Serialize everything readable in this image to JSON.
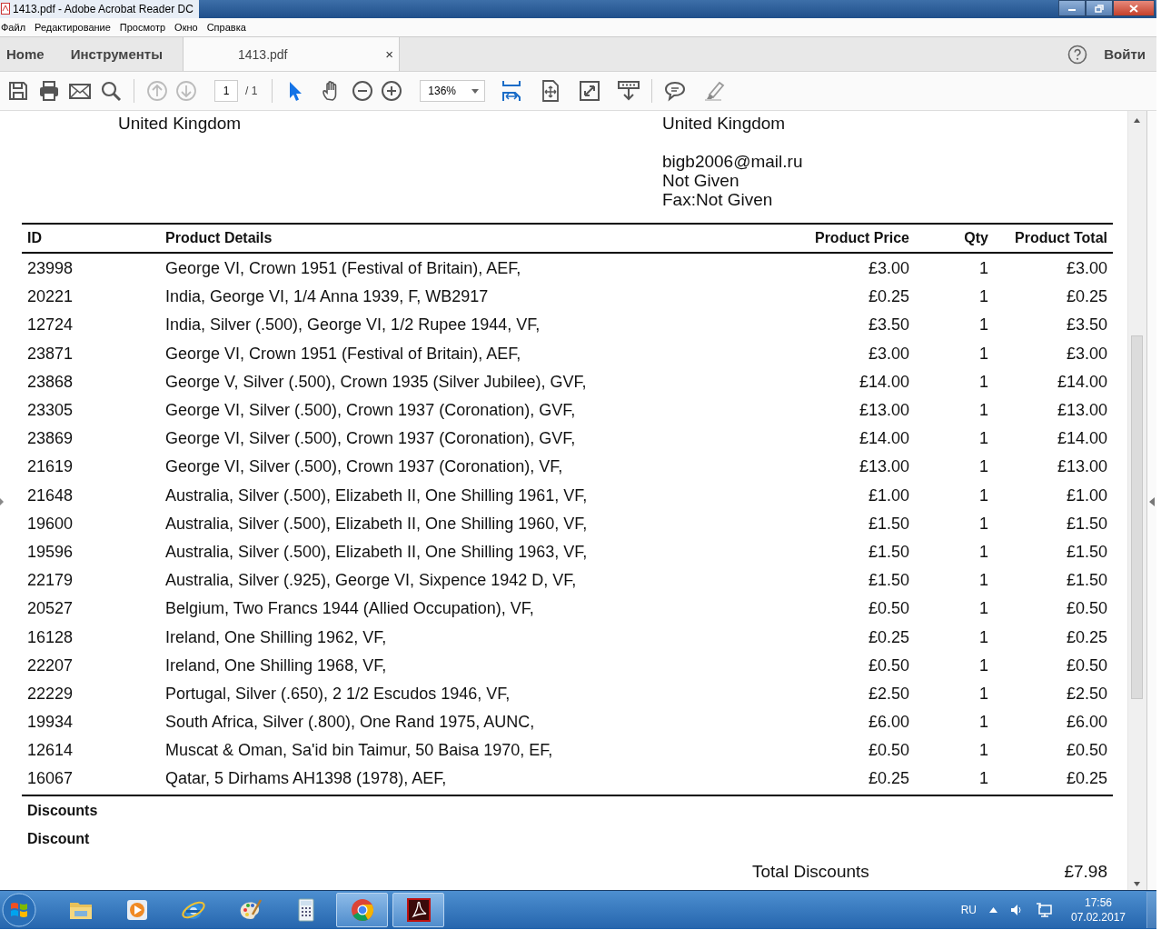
{
  "window": {
    "title": "1413.pdf - Adobe Acrobat Reader DC"
  },
  "menu": [
    "Файл",
    "Редактирование",
    "Просмотр",
    "Окно",
    "Справка"
  ],
  "tabs": [
    {
      "label": "Home",
      "kind": "nav",
      "selected": false
    },
    {
      "label": "Инструменты",
      "kind": "nav",
      "selected": false
    },
    {
      "label": "1413.pdf",
      "kind": "document",
      "close": "×",
      "selected": true
    }
  ],
  "sign_in": "Войти",
  "toolbar": {
    "prev_page_disabled": true,
    "next_page_disabled": true,
    "page": "1",
    "page_count": "/ 1",
    "zoom": "136%",
    "tools": [
      {
        "kind": "select",
        "selected": true
      },
      {
        "kind": "hand",
        "selected": false
      }
    ]
  },
  "document": {
    "sender_lines": [
      "United Kingdom"
    ],
    "recipient_lines": [
      "United Kingdom"
    ],
    "recipient_contact_lines": [
      "bigb2006@mail.ru",
      "Not Given",
      "Fax:Not Given"
    ],
    "table": {
      "columns": [
        "ID",
        "Product Details",
        "Product Price",
        "Qty",
        "Product Total"
      ],
      "rows": [
        [
          "23998",
          "George VI, Crown 1951 (Festival of Britain), AEF,",
          "£3.00",
          "1",
          "£3.00"
        ],
        [
          "20221",
          "India, George VI, 1/4 Anna 1939, F, WB2917",
          "£0.25",
          "1",
          "£0.25"
        ],
        [
          "12724",
          "India, Silver (.500), George VI, 1/2 Rupee 1944, VF,",
          "£3.50",
          "1",
          "£3.50"
        ],
        [
          "23871",
          "George VI, Crown 1951 (Festival of Britain), AEF,",
          "£3.00",
          "1",
          "£3.00"
        ],
        [
          "23868",
          "George V, Silver (.500), Crown 1935 (Silver Jubilee), GVF,",
          "£14.00",
          "1",
          "£14.00"
        ],
        [
          "23305",
          "George VI, Silver (.500), Crown 1937 (Coronation), GVF,",
          "£13.00",
          "1",
          "£13.00"
        ],
        [
          "23869",
          "George VI, Silver (.500), Crown 1937 (Coronation), GVF,",
          "£14.00",
          "1",
          "£14.00"
        ],
        [
          "21619",
          "George VI, Silver (.500), Crown 1937 (Coronation), VF,",
          "£13.00",
          "1",
          "£13.00"
        ],
        [
          "21648",
          "Australia, Silver (.500), Elizabeth II, One Shilling 1961, VF,",
          "£1.00",
          "1",
          "£1.00"
        ],
        [
          "19600",
          "Australia, Silver (.500), Elizabeth II, One Shilling 1960, VF,",
          "£1.50",
          "1",
          "£1.50"
        ],
        [
          "19596",
          "Australia, Silver (.500), Elizabeth II, One Shilling 1963, VF,",
          "£1.50",
          "1",
          "£1.50"
        ],
        [
          "22179",
          "Australia, Silver (.925), George VI, Sixpence 1942 D, VF,",
          "£1.50",
          "1",
          "£1.50"
        ],
        [
          "20527",
          "Belgium, Two Francs 1944 (Allied Occupation), VF,",
          "£0.50",
          "1",
          "£0.50"
        ],
        [
          "16128",
          "Ireland, One Shilling 1962, VF,",
          "£0.25",
          "1",
          "£0.25"
        ],
        [
          "22207",
          "Ireland, One Shilling 1968, VF,",
          "£0.50",
          "1",
          "£0.50"
        ],
        [
          "22229",
          "Portugal, Silver (.650), 2 1/2 Escudos 1946, VF,",
          "£2.50",
          "1",
          "£2.50"
        ],
        [
          "19934",
          "South Africa, Silver (.800), One Rand 1975, AUNC,",
          "£6.00",
          "1",
          "£6.00"
        ],
        [
          "12614",
          "Muscat & Oman, Sa'id bin Taimur, 50 Baisa 1970, EF,",
          "£0.50",
          "1",
          "£0.50"
        ],
        [
          "16067",
          "Qatar, 5 Dirhams AH1398 (1978), AEF,",
          "£0.25",
          "1",
          "£0.25"
        ]
      ]
    },
    "discounts_heading": "Discounts",
    "discount_label": "Discount",
    "total_discounts_label": "Total Discounts",
    "total_discounts_value": "£7.98"
  },
  "taskbar": {
    "apps": [
      {
        "kind": "explorer",
        "selected": false
      },
      {
        "kind": "media",
        "selected": false
      },
      {
        "kind": "ie",
        "selected": false
      },
      {
        "kind": "paint",
        "selected": false
      },
      {
        "kind": "calculator",
        "selected": false
      },
      {
        "kind": "chrome",
        "selected": true
      },
      {
        "kind": "acrobat",
        "selected": true
      }
    ],
    "language": "RU",
    "time": "17:56",
    "date": "07.02.2017"
  }
}
